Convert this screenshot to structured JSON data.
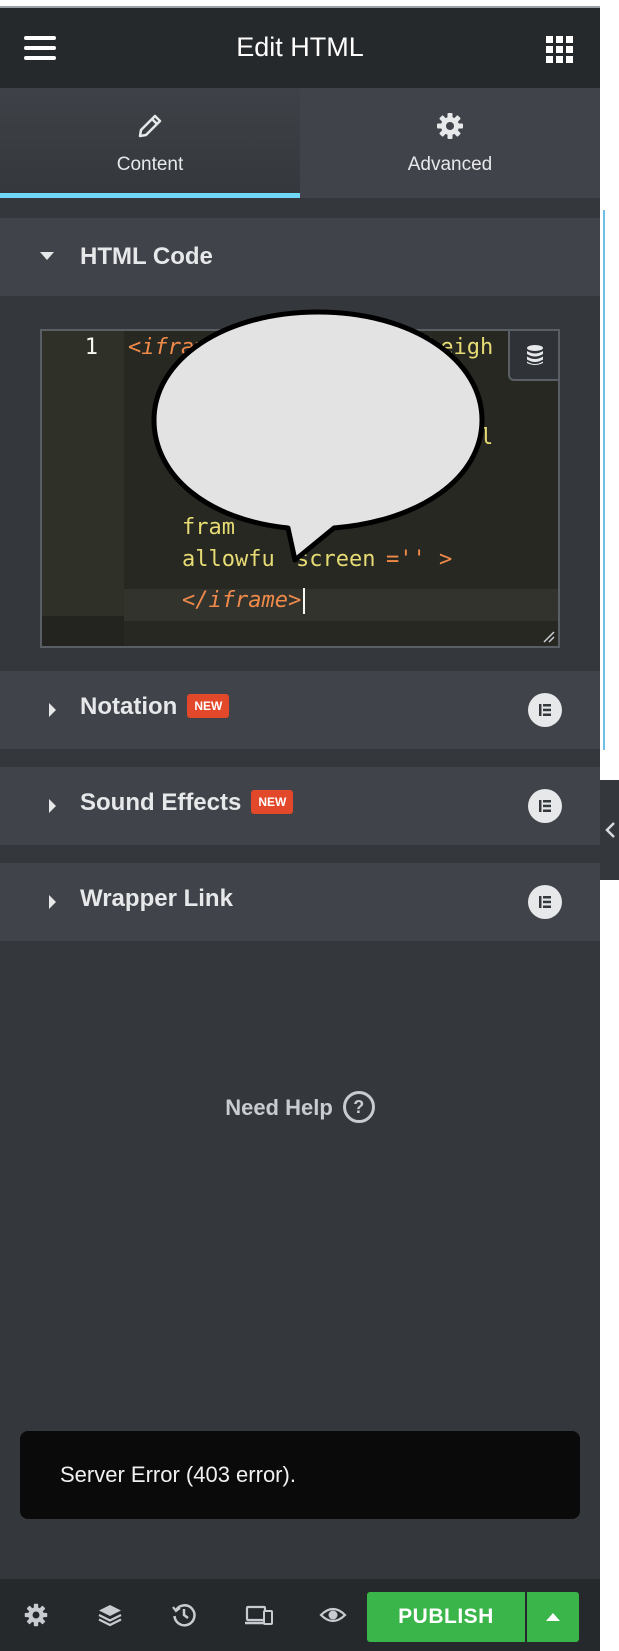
{
  "header": {
    "title": "Edit HTML",
    "menu_icon": "hamburger-icon",
    "apps_icon": "grid-icon"
  },
  "tabs": [
    {
      "label": "Content",
      "icon": "pencil-icon",
      "active": true
    },
    {
      "label": "Advanced",
      "icon": "gear-icon",
      "active": false
    }
  ],
  "sections": {
    "html_code": {
      "title": "HTML Code",
      "expanded": true
    },
    "notation": {
      "title": "Notation",
      "badge": "NEW"
    },
    "sound_effects": {
      "title": "Sound Effects",
      "badge": "NEW"
    },
    "wrapper_link": {
      "title": "Wrapper Link"
    }
  },
  "code_editor": {
    "line_number": "1",
    "visible_fragments": {
      "l1_tag": "<ifram",
      "l1_tail": "heigh",
      "l2_tail": "l",
      "l4_head": "fram",
      "l5": "allowfu",
      "l5_tail": "screen",
      "l5_rest": "='' >",
      "l6": "</iframe>"
    }
  },
  "help": {
    "label": "Need Help",
    "icon": "question-icon"
  },
  "toast": {
    "message": "Server Error (403 error)."
  },
  "footer": {
    "publish_label": "PUBLISH",
    "icons": [
      "settings-icon",
      "layers-icon",
      "history-icon",
      "responsive-icon",
      "preview-eye-icon"
    ]
  },
  "colors": {
    "panel_bg": "#34383c",
    "header_bg": "#26292c",
    "accent_blue": "#71d7f7",
    "badge_red": "#e2492a",
    "publish_green": "#39b54a"
  }
}
